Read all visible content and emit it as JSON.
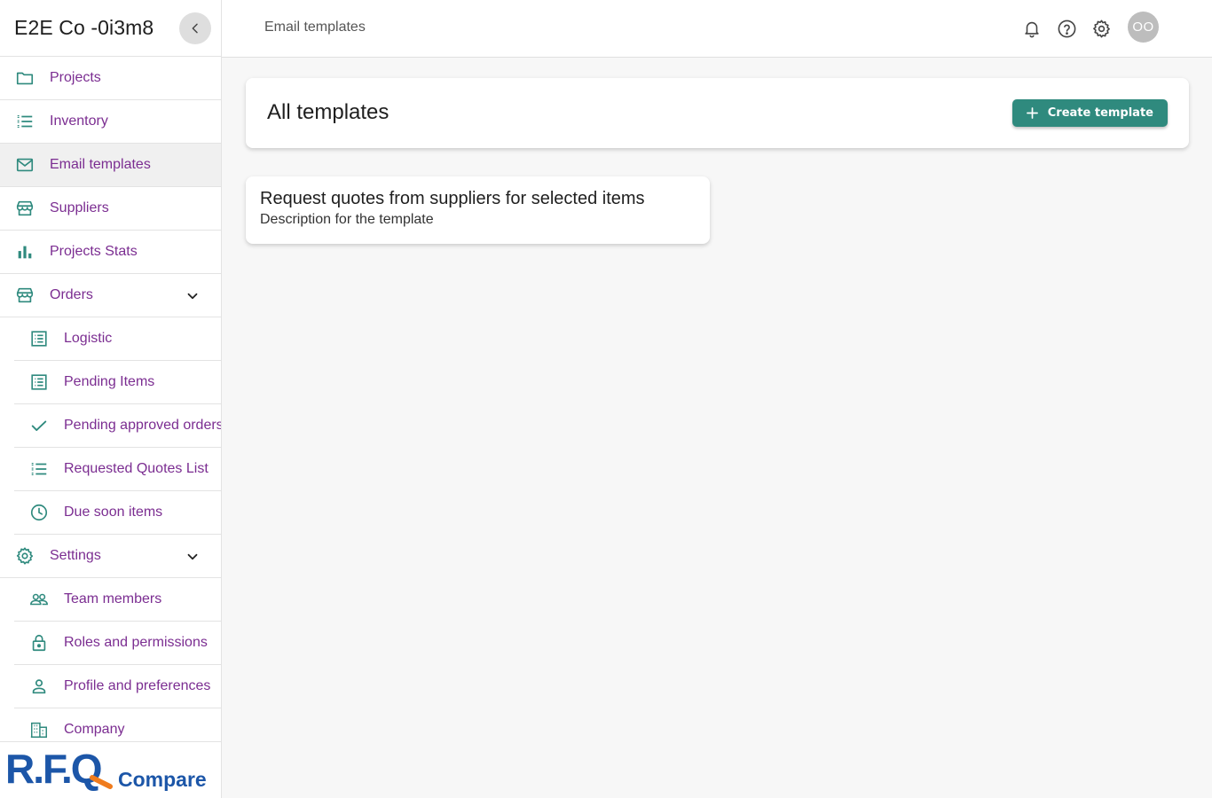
{
  "sidebar": {
    "company_name": "E2E Co -0i3m8",
    "items": [
      {
        "label": "Projects",
        "icon": "folder-icon"
      },
      {
        "label": "Inventory",
        "icon": "list-icon"
      },
      {
        "label": "Email templates",
        "icon": "mail-icon"
      },
      {
        "label": "Suppliers",
        "icon": "store-icon"
      },
      {
        "label": "Projects Stats",
        "icon": "bar-chart-icon"
      },
      {
        "label": "Orders",
        "icon": "store-icon"
      },
      {
        "label": "Logistic",
        "icon": "list-alt-icon"
      },
      {
        "label": "Pending Items",
        "icon": "list-alt-icon"
      },
      {
        "label": "Pending approved orders",
        "icon": "check-icon"
      },
      {
        "label": "Requested Quotes List",
        "icon": "list-icon"
      },
      {
        "label": "Due soon items",
        "icon": "clock-icon"
      },
      {
        "label": "Settings",
        "icon": "gear-icon"
      },
      {
        "label": "Team members",
        "icon": "people-icon"
      },
      {
        "label": "Roles and permissions",
        "icon": "lock-icon"
      },
      {
        "label": "Profile and preferences",
        "icon": "person-icon"
      },
      {
        "label": "Company",
        "icon": "building-icon"
      }
    ],
    "logo": {
      "part1": "R.F.Q",
      "part2": "Compare"
    }
  },
  "topbar": {
    "title": "Email templates",
    "avatar_initials": "OO"
  },
  "main": {
    "header_title": "All templates",
    "create_label": "Create template",
    "templates": [
      {
        "title": "Request quotes from suppliers for selected items",
        "description": "Description for the template"
      }
    ]
  },
  "colors": {
    "accent": "#2f8a7e",
    "nav_text": "#7b2d91",
    "logo_blue": "#1c56a8",
    "logo_orange": "#f07c1e"
  }
}
